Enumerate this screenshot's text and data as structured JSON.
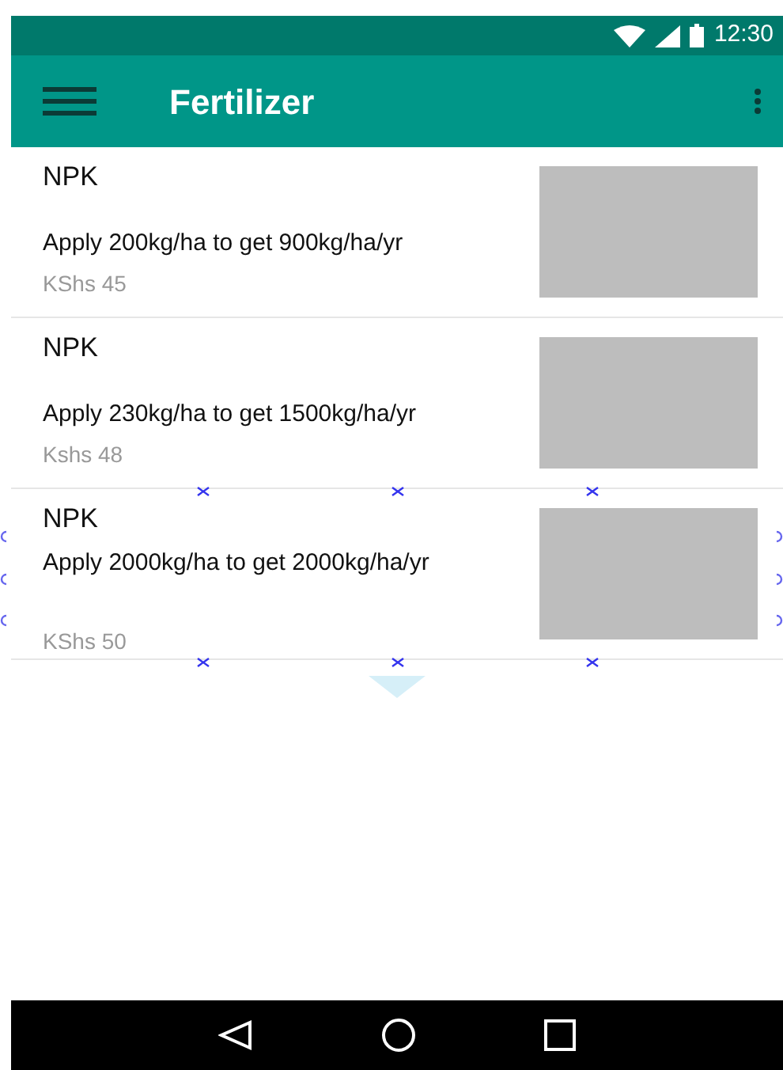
{
  "status_bar": {
    "time": "12:30"
  },
  "app_bar": {
    "title": "Fertilizer"
  },
  "items": [
    {
      "title": "NPK",
      "description": "Apply 200kg/ha to get 900kg/ha/yr",
      "price": "KShs 45",
      "kind": "spaced",
      "selected": false
    },
    {
      "title": "NPK",
      "description": "Apply 230kg/ha to get 1500kg/ha/yr",
      "price": "Kshs 48",
      "kind": "spaced",
      "selected": false
    },
    {
      "title": "NPK",
      "description": "Apply 2000kg/ha to get 2000kg/ha/yr",
      "price": "KShs 50",
      "kind": "compact",
      "selected": true
    }
  ]
}
